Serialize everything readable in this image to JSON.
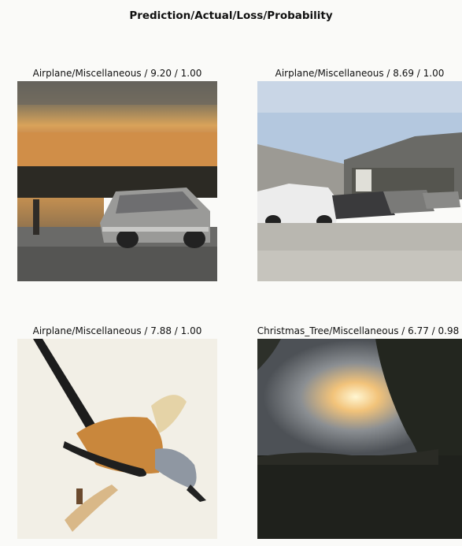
{
  "figure": {
    "title": "Prediction/Actual/Loss/Probability"
  },
  "panels": [
    {
      "title": "Airplane/Miscellaneous / 9.20 / 1.00",
      "image_content": "sunset lake with silver car"
    },
    {
      "title": "Airplane/Miscellaneous / 8.69 / 1.00",
      "image_content": "parking lot with cars and building"
    },
    {
      "title": "Airplane/Miscellaneous / 7.88 / 1.00",
      "image_content": "bird illustration"
    },
    {
      "title": "Christmas_Tree/Miscellaneous / 6.77 / 0.98",
      "image_content": "sunset through trees"
    }
  ]
}
